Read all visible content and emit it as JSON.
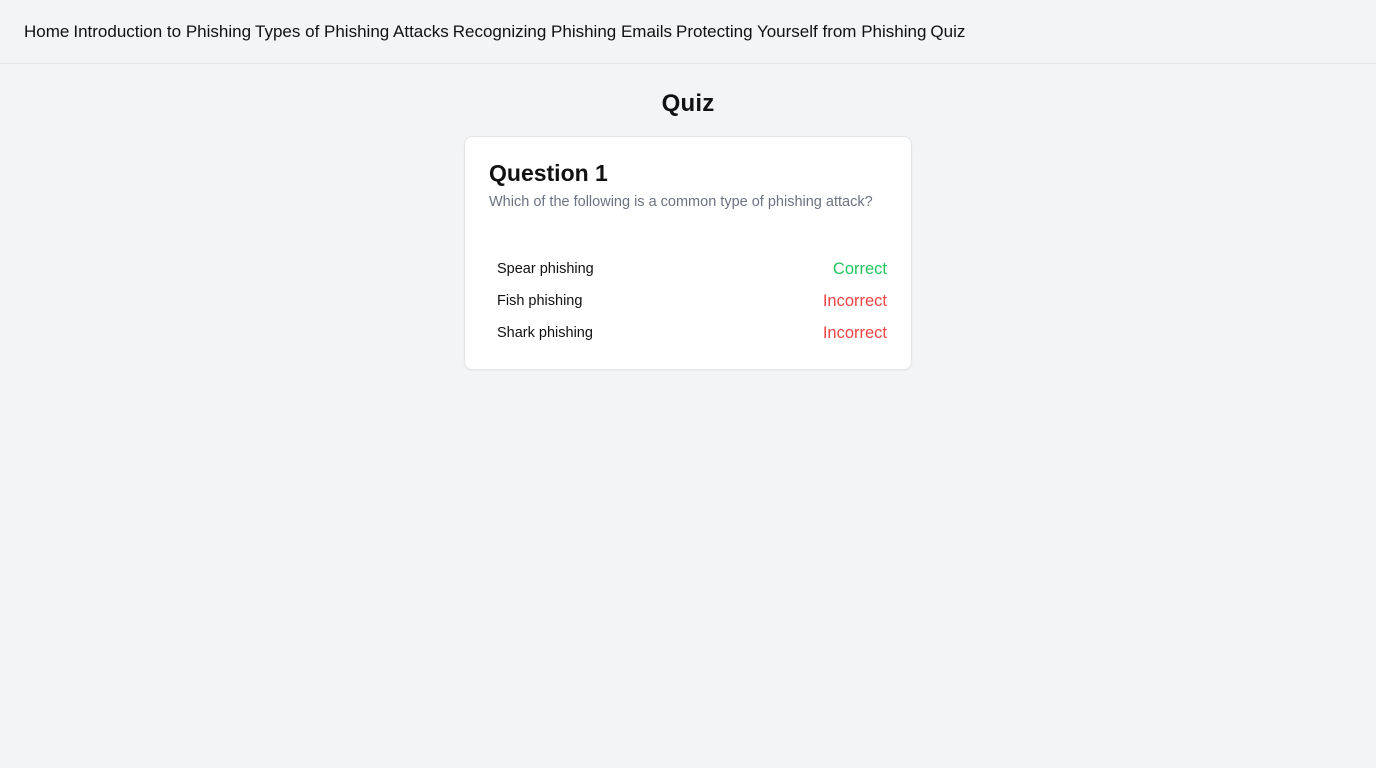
{
  "nav": {
    "links": [
      "Home",
      "Introduction to Phishing",
      "Types of Phishing Attacks",
      "Recognizing Phishing Emails",
      "Protecting Yourself from Phishing",
      "Quiz"
    ]
  },
  "page": {
    "title": "Quiz"
  },
  "question": {
    "title": "Question 1",
    "text": "Which of the following is a common type of phishing attack?",
    "options": [
      {
        "label": "Spear phishing",
        "status": "Correct"
      },
      {
        "label": "Fish phishing",
        "status": "Incorrect"
      },
      {
        "label": "Shark phishing",
        "status": "Incorrect"
      }
    ]
  },
  "colors": {
    "correct": "#22c55e",
    "incorrect": "#ef4444",
    "muted_text": "#6b7280",
    "background": "#f3f4f6"
  }
}
